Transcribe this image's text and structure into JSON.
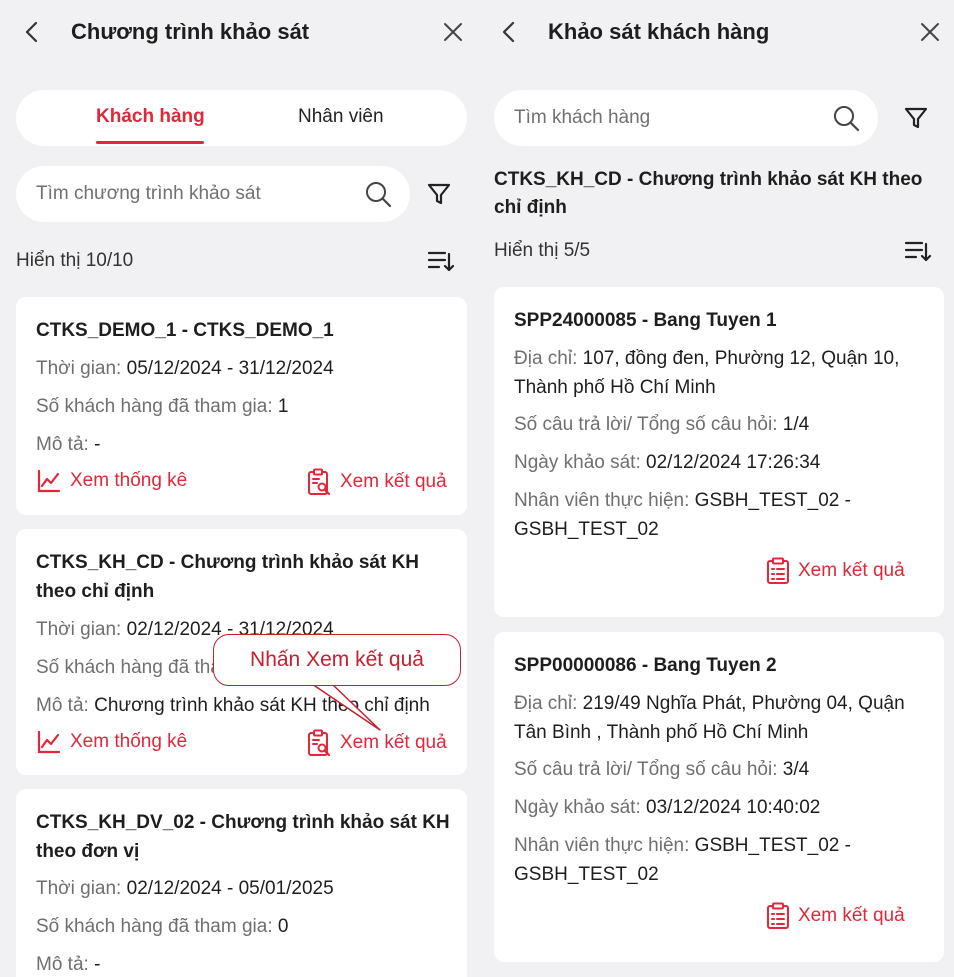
{
  "left_panel": {
    "title": "Chương trình khảo sát",
    "tabs": [
      {
        "label": "Khách hàng",
        "active": true
      },
      {
        "label": "Nhân viên",
        "active": false
      }
    ],
    "search": {
      "placeholder": "Tìm chương trình khảo sát"
    },
    "count_text": "Hiển thị 10/10",
    "cards": [
      {
        "title": "CTKS_DEMO_1 - CTKS_DEMO_1",
        "time_label": "Thời gian:",
        "time_value": "05/12/2024 - 31/12/2024",
        "customers_label": "Số khách hàng đã tham gia:",
        "customers_value": "1",
        "desc_label": "Mô tả:",
        "desc_value": "-",
        "stats_label": "Xem thống kê",
        "results_label": "Xem kết quả"
      },
      {
        "title_line1": "CTKS_KH_CD - Chương trình khảo sát KH",
        "title_line2": "theo chỉ định",
        "time_label": "Thời gian:",
        "time_value": "02/12/2024 - 31/12/2024",
        "customers_label": "Số khách hàng đã tham gia:",
        "customers_value": "0",
        "desc_label": "Mô tả:",
        "desc_value": "Chương trình khảo sát KH theo chỉ định",
        "stats_label": "Xem thống kê",
        "results_label": "Xem kết quả"
      },
      {
        "title_line1": "CTKS_KH_DV_02 - Chương trình khảo sát KH",
        "title_line2": "theo đơn vị",
        "time_label": "Thời gian:",
        "time_value": "02/12/2024 - 05/01/2025",
        "customers_label": "Số khách hàng đã tham gia:",
        "customers_value": "0",
        "desc_label": "Mô tả:",
        "desc_value": "-"
      }
    ],
    "callout_text": "Nhấn Xem kết quả"
  },
  "right_panel": {
    "title": "Khảo sát khách hàng",
    "search": {
      "placeholder": "Tìm khách hàng"
    },
    "subheading_line1": "CTKS_KH_CD - Chương trình khảo sát KH theo",
    "subheading_line2": "chỉ định",
    "count_text": "Hiển thị 5/5",
    "cards": [
      {
        "title": "SPP24000085 - Bang Tuyen 1",
        "address_label": "Địa chỉ:",
        "address_line1": "107, đồng đen, Phường 12, Quận 10,",
        "address_line2": "Thành phố Hồ Chí Minh",
        "answers_label": "Số câu trả lời/ Tổng số câu hỏi:",
        "answers_value": "1/4",
        "date_label": "Ngày khảo sát:",
        "date_value": "02/12/2024 17:26:34",
        "staff_label": "Nhân viên thực hiện:",
        "staff_line1": "GSBH_TEST_02 -",
        "staff_line2": "GSBH_TEST_02",
        "results_label": "Xem kết quả"
      },
      {
        "title": "SPP00000086 - Bang Tuyen 2",
        "address_label": "Địa chỉ:",
        "address_line1": "219/49 Nghĩa Phát, Phường 04, Quận",
        "address_line2": "Tân Bình , Thành phố Hồ Chí Minh",
        "answers_label": "Số câu trả lời/ Tổng số câu hỏi:",
        "answers_value": "3/4",
        "date_label": "Ngày khảo sát:",
        "date_value": "03/12/2024 10:40:02",
        "staff_label": "Nhân viên thực hiện:",
        "staff_line1": "GSBH_TEST_02 -",
        "staff_line2": "GSBH_TEST_02",
        "results_label": "Xem kết quả"
      }
    ]
  },
  "icons": {
    "back": "chevron-left-icon",
    "close": "close-icon",
    "search": "search-icon",
    "filter": "filter-icon",
    "sort": "sort-icon",
    "stats": "line-chart-icon",
    "results": "clipboard-search-icon",
    "results_plain": "clipboard-list-icon"
  },
  "colors": {
    "accent": "#e0283a",
    "background": "#f1f1f3",
    "card": "#ffffff",
    "label_gray": "#6f6f6f"
  }
}
